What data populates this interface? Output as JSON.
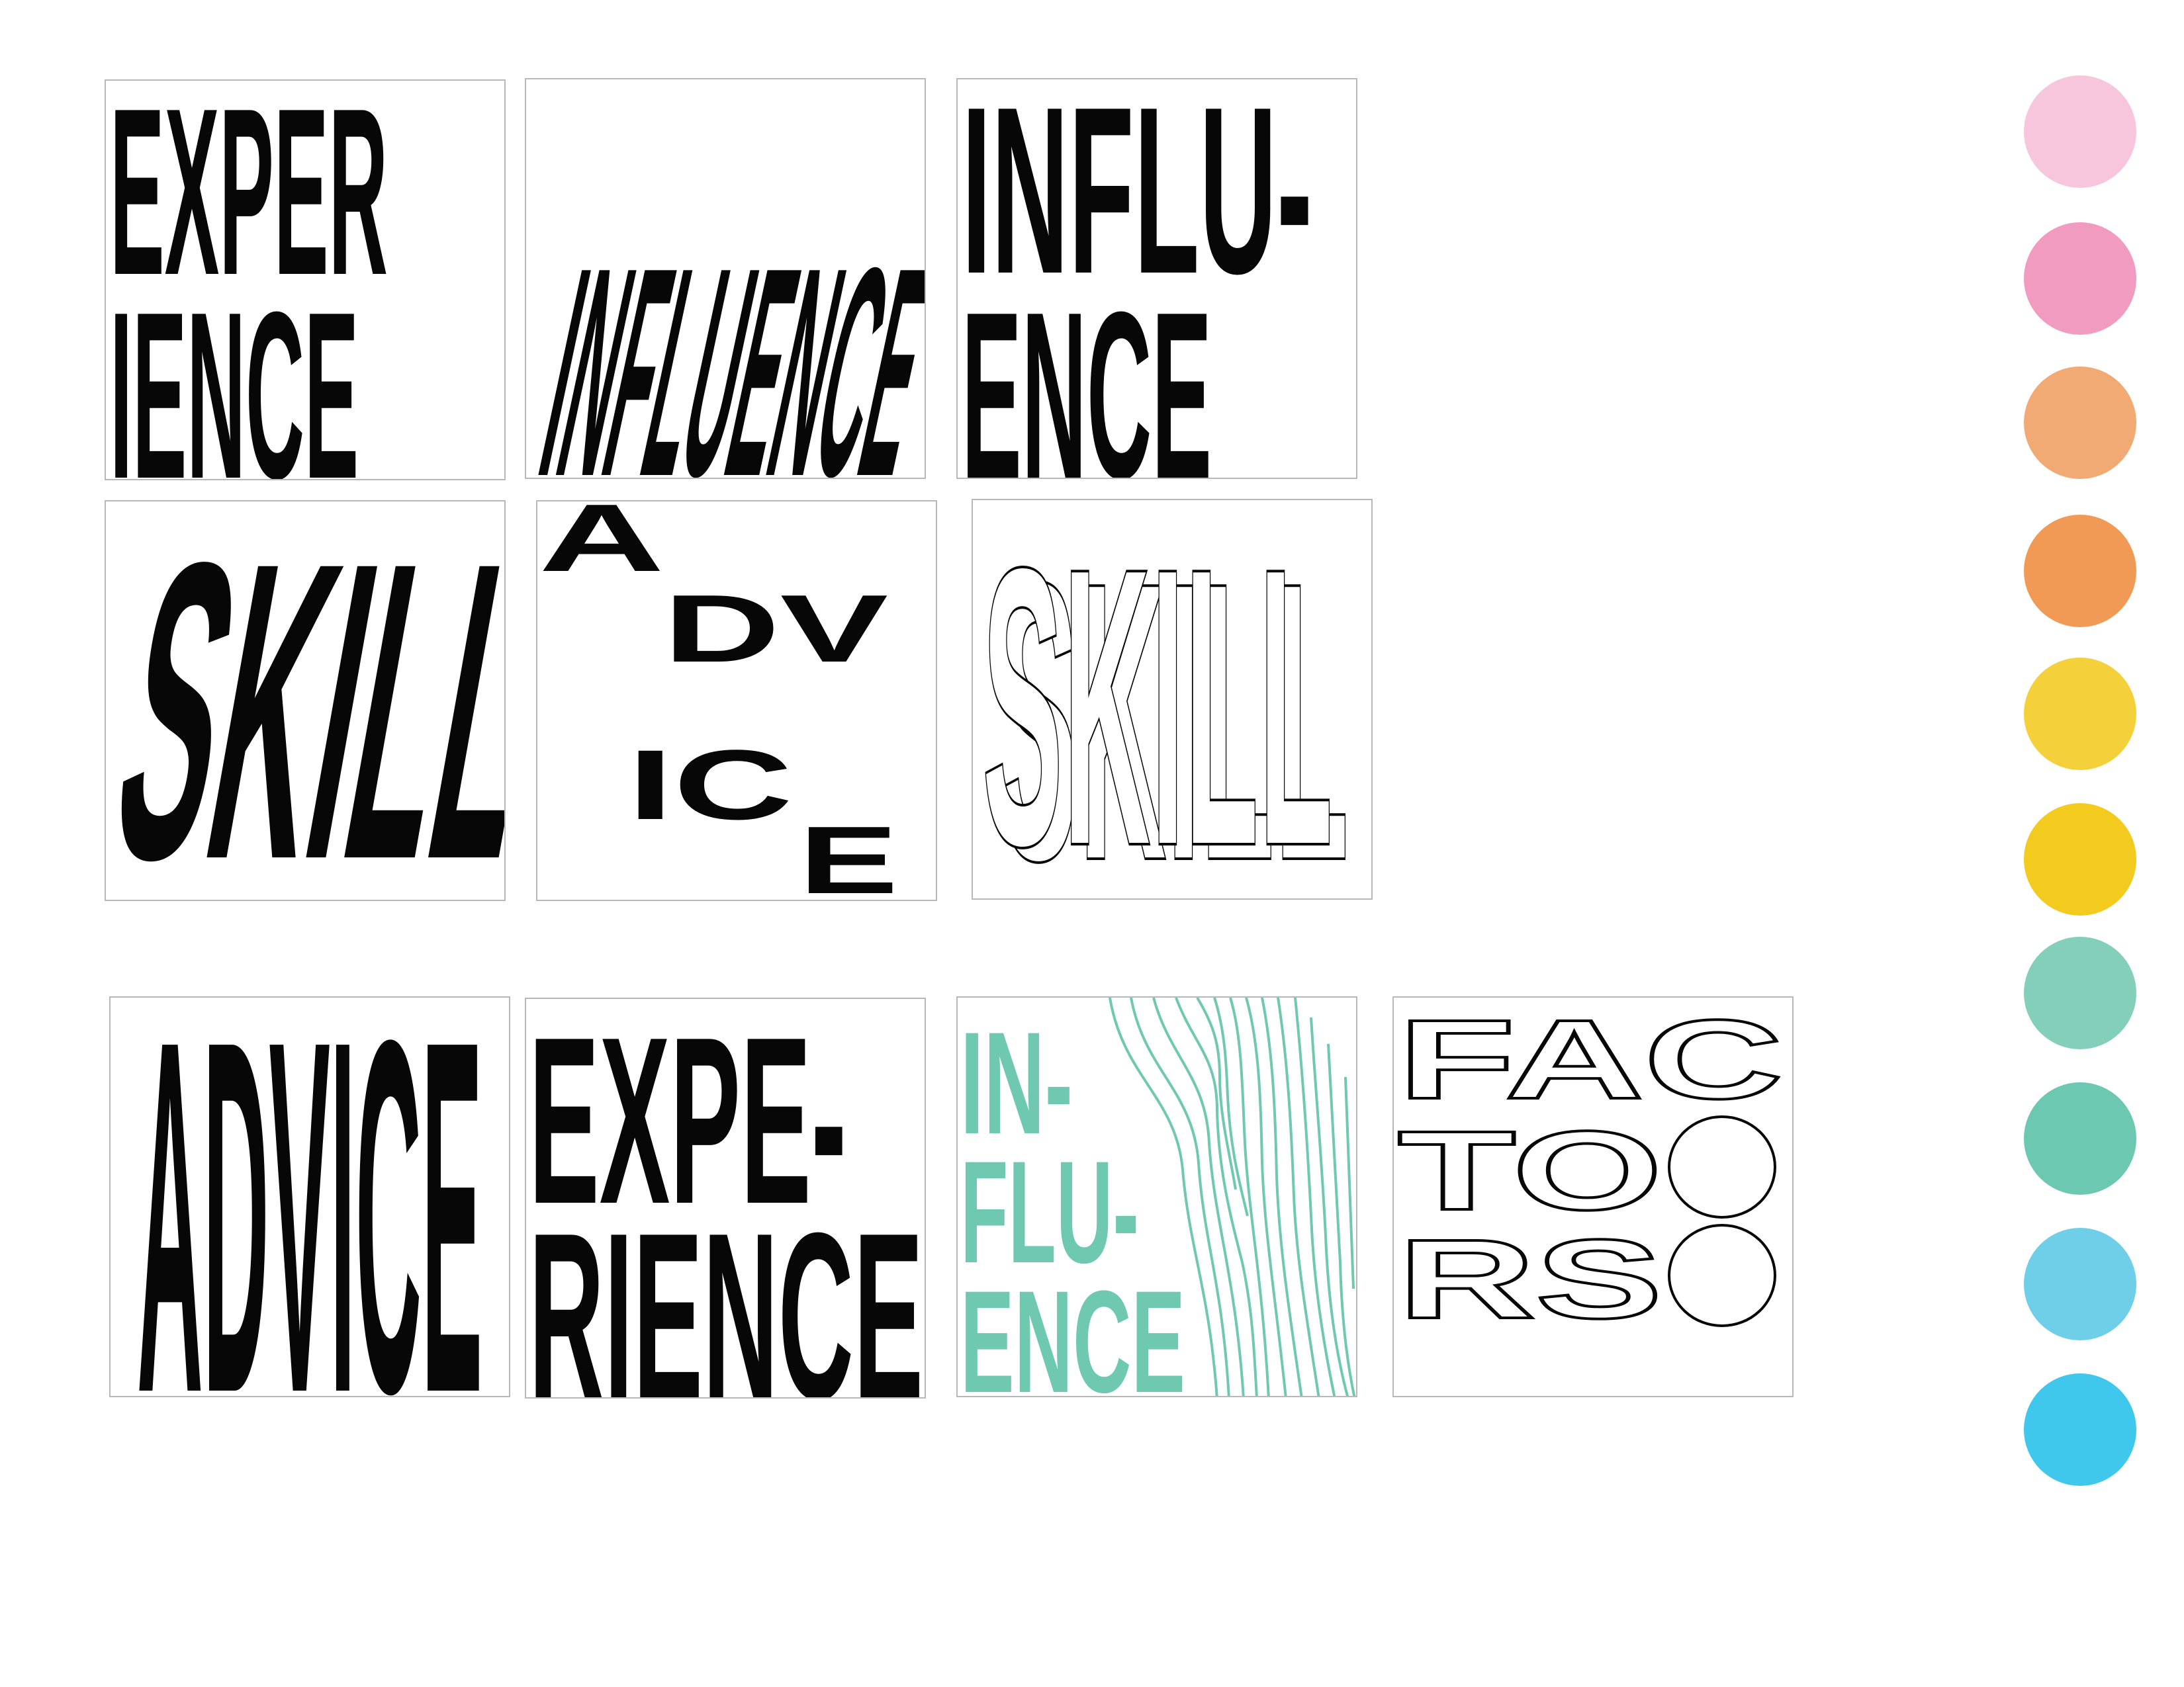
{
  "tiles": [
    {
      "lines": [
        "EXPER",
        "IENCE"
      ]
    },
    {
      "word": "INFLUENCE"
    },
    {
      "lines": [
        "INFLU-",
        "ENCE"
      ]
    },
    {
      "word": "SKILL"
    },
    {
      "letters": [
        "A",
        "DV",
        "IC",
        "E"
      ]
    },
    {
      "word": "SKILL"
    },
    {
      "word": "ADVICE"
    },
    {
      "lines": [
        "EXPE-",
        "RIENCE"
      ]
    },
    {
      "lines": [
        "IN-",
        "FLU-",
        "ENCE"
      ],
      "accent": "#6fc8b0"
    },
    {
      "lines": [
        "FAC",
        "TO",
        "RS"
      ]
    }
  ],
  "swatches": [
    {
      "color": "#f8c6dc"
    },
    {
      "color": "#f29bc0"
    },
    {
      "color": "#f2aa74"
    },
    {
      "color": "#f09a56"
    },
    {
      "color": "#f4d03a"
    },
    {
      "color": "#f2cb1e"
    },
    {
      "color": "#83cfb9"
    },
    {
      "color": "#6cc8b1"
    },
    {
      "color": "#6fcfe8"
    },
    {
      "color": "#3fc8ec"
    }
  ]
}
